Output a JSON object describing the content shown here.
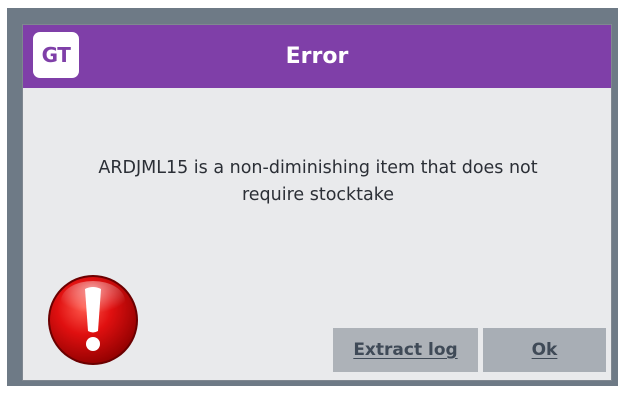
{
  "window": {
    "title": "Error",
    "logo_text": "GT"
  },
  "message": {
    "line1": "ARDJML15 is a non-diminishing item that does not",
    "line2": "require stocktake"
  },
  "buttons": {
    "extract_log_label": "Extract log",
    "ok_label": "Ok"
  },
  "icons": {
    "error": "error-exclamation-icon"
  },
  "colors": {
    "title_bar": "#7f3fa8",
    "dialog_background": "#e9eaec",
    "button_background": "#adb2b8",
    "error_red": "#d40000"
  }
}
